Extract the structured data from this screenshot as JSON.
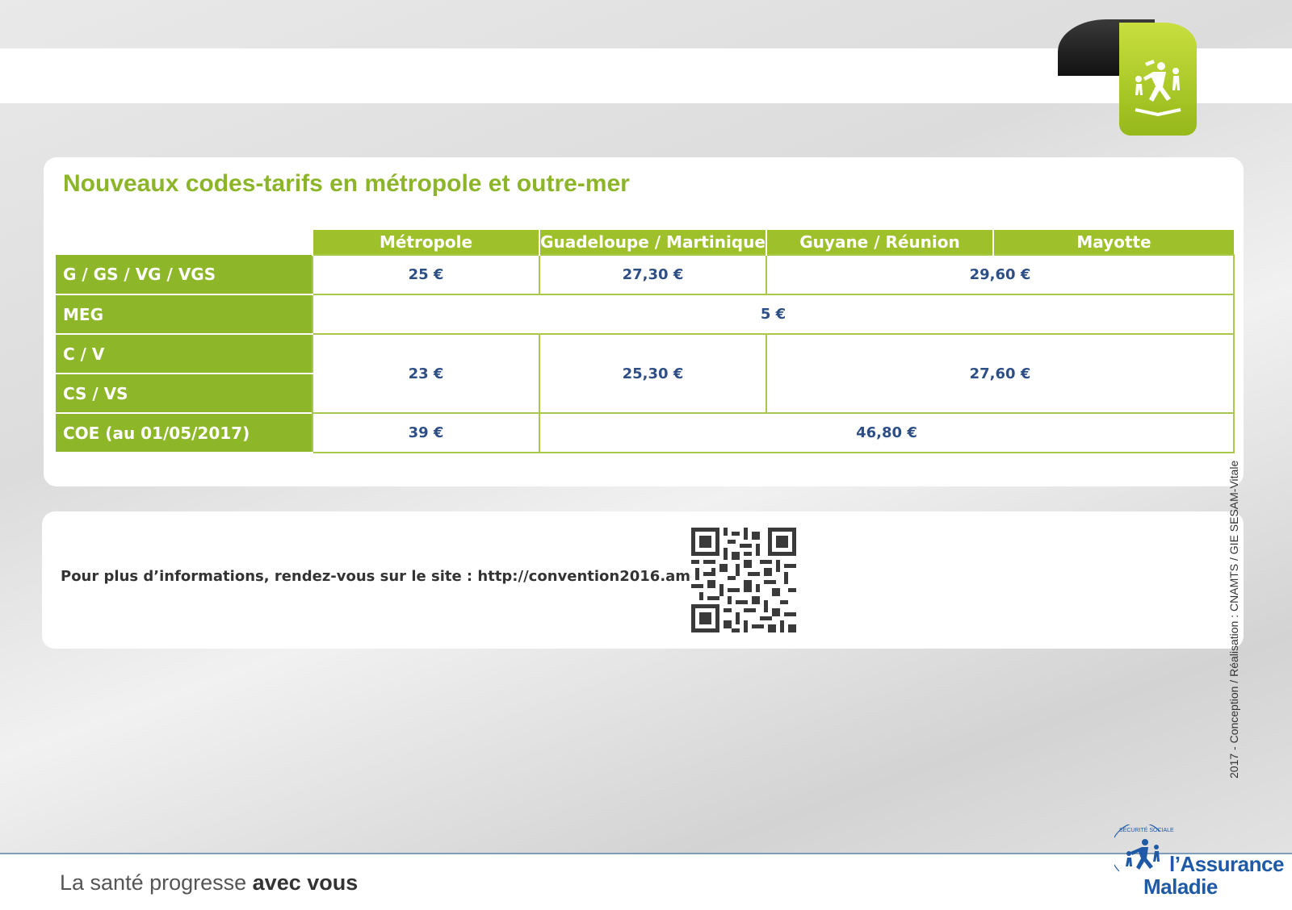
{
  "document": {
    "title": "Nouveaux codes-tarifs en métropole et outre-mer",
    "table": {
      "columns": [
        "Métropole",
        "Guadeloupe / Martinique",
        "Guyane / Réunion",
        "Mayotte"
      ],
      "rows": [
        {
          "label": "G / GS / VG / VGS",
          "values": [
            "25 €",
            "27,30 €",
            "29,60 €"
          ]
        },
        {
          "label": "MEG",
          "values": [
            "5 €"
          ]
        },
        {
          "label": "C / V",
          "values": [
            "23 €",
            "25,30 €",
            "27,60 €"
          ]
        },
        {
          "label": "CS / VS",
          "values": []
        },
        {
          "label": "COE (au 01/05/2017)",
          "values": [
            "39 €",
            "46,80 €"
          ]
        }
      ]
    },
    "info_text": "Pour plus d’informations, rendez-vous sur le site : http://convention2016.ameli.fr/",
    "side_credit": "2017 - Conception / Réalisation : CNAMTS / GIE SESAM-Vitale",
    "footer": {
      "slogan_regular": "La santé progresse ",
      "slogan_bold": "avec vous",
      "logo_arc": "SÉCURITÉ SOCIALE",
      "logo_line1": "l’Assurance",
      "logo_line2": "Maladie"
    }
  },
  "colors": {
    "accent_green": "#8db52a",
    "header_green": "#9dc02b",
    "value_blue": "#2e4f86",
    "logo_blue": "#1f5aa6"
  },
  "icons": [
    "family-icon",
    "qr-code-icon",
    "assurance-maladie-logo-icon"
  ]
}
